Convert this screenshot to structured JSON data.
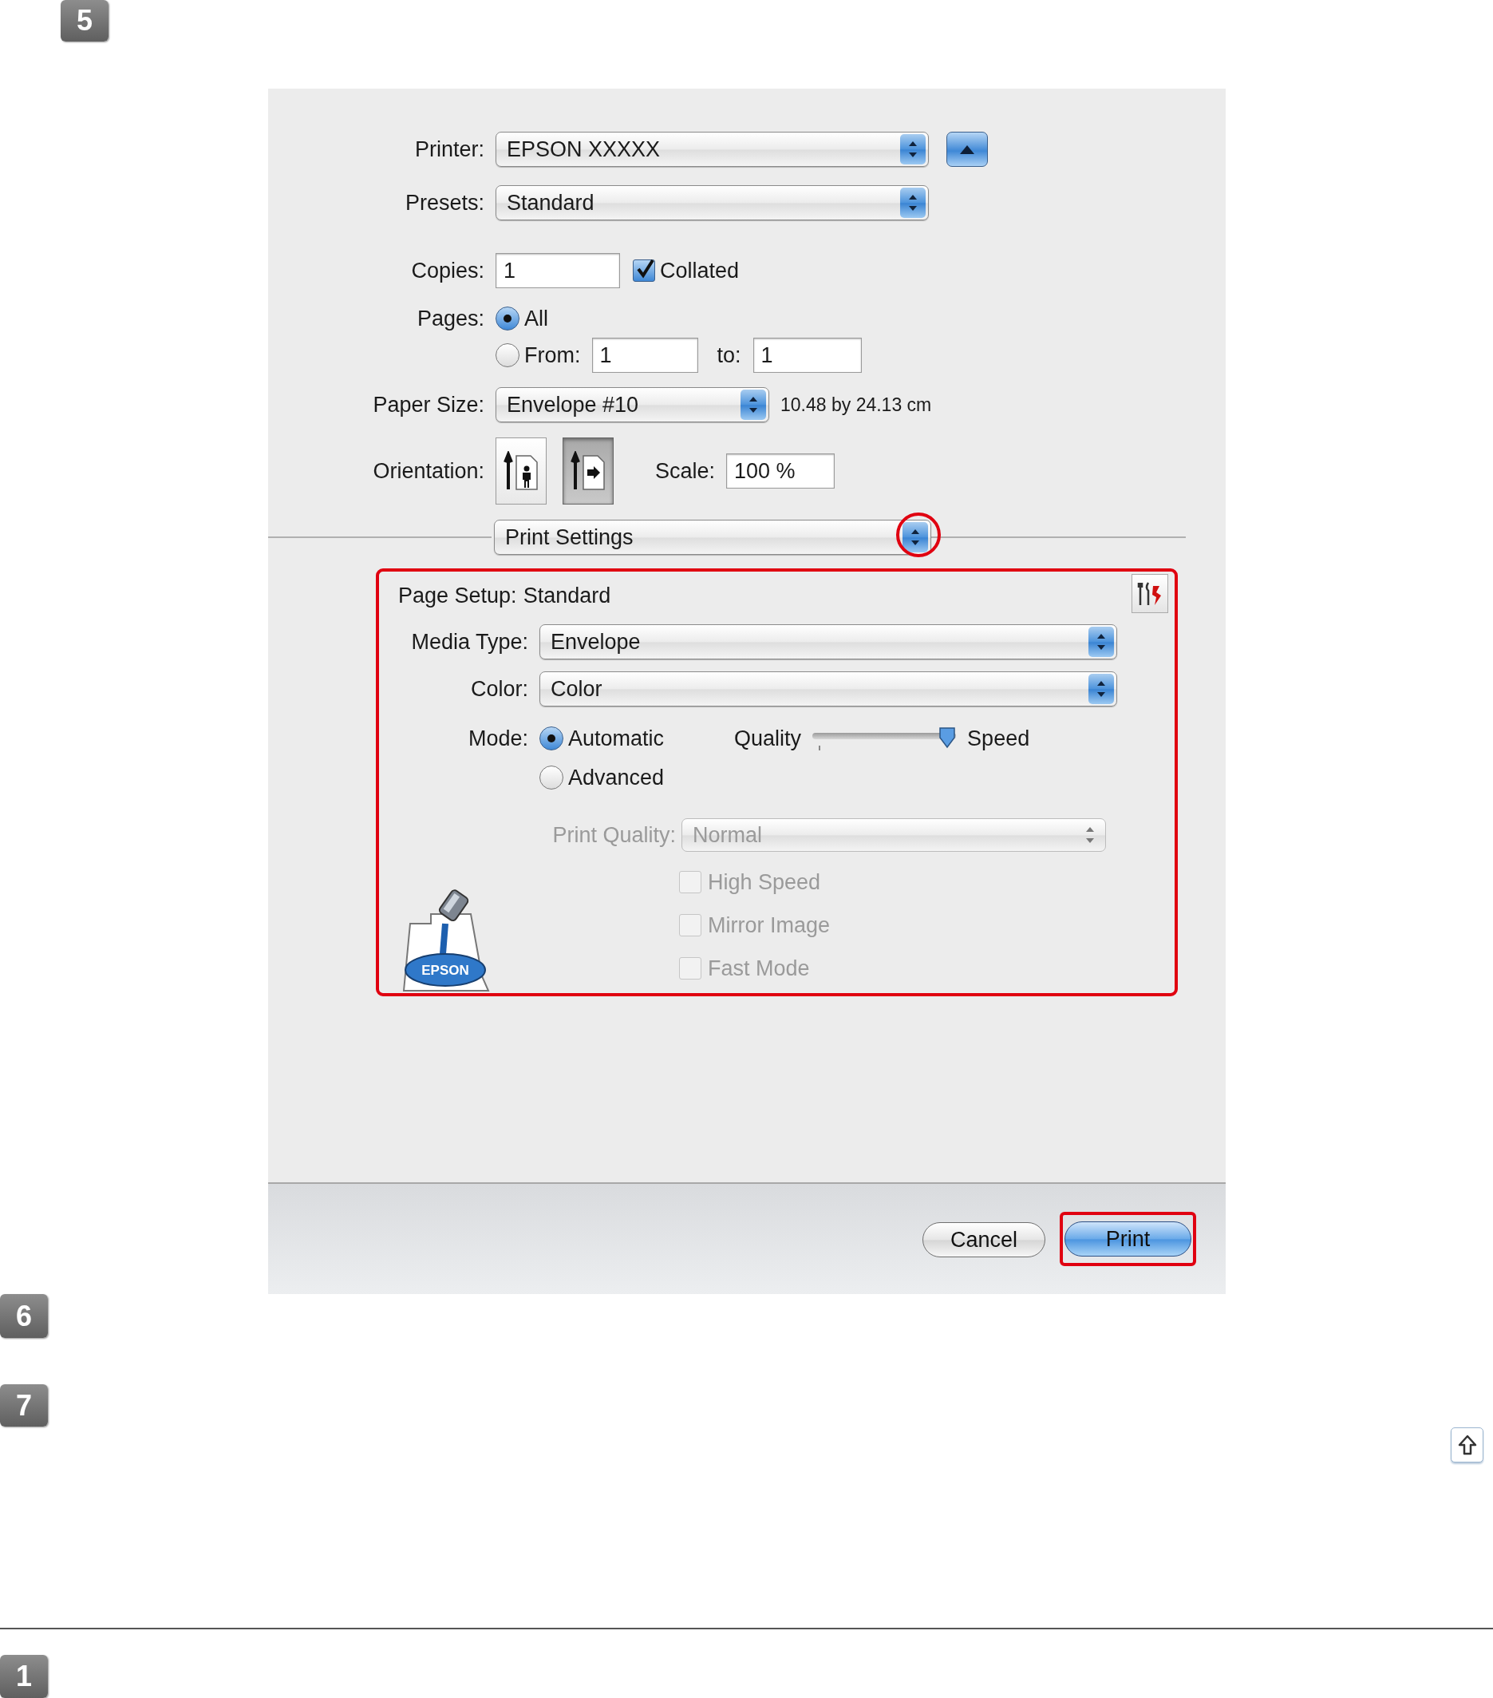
{
  "steps": [
    {
      "number": "5"
    },
    {
      "number": "6"
    },
    {
      "number": "7"
    },
    {
      "number": "1"
    }
  ],
  "dialog": {
    "printer": {
      "label": "Printer:",
      "value": "EPSON XXXXX"
    },
    "presets": {
      "label": "Presets:",
      "value": "Standard"
    },
    "copies": {
      "label": "Copies:",
      "value": "1",
      "collated": {
        "label": "Collated",
        "checked": true
      }
    },
    "pages": {
      "label": "Pages:",
      "options": [
        {
          "label": "All",
          "selected": true
        },
        {
          "label": "From:",
          "selected": false
        }
      ],
      "from": "1",
      "to_label": "to:",
      "to": "1"
    },
    "paper_size": {
      "label": "Paper Size:",
      "value": "Envelope #10",
      "dimensions": "10.48 by 24.13 cm"
    },
    "orientation": {
      "label": "Orientation:",
      "options": [
        {
          "kind": "portrait",
          "selected": false
        },
        {
          "kind": "landscape",
          "selected": true
        }
      ]
    },
    "scale": {
      "label": "Scale:",
      "value": "100 %"
    },
    "panel_menu": {
      "value": "Print Settings"
    },
    "print_settings": {
      "page_setup": {
        "label": "Page Setup:",
        "value": "Standard"
      },
      "media_type": {
        "label": "Media Type:",
        "value": "Envelope"
      },
      "color": {
        "label": "Color:",
        "value": "Color"
      },
      "mode": {
        "label": "Mode:",
        "options": [
          {
            "label": "Automatic",
            "selected": true
          },
          {
            "label": "Advanced",
            "selected": false
          }
        ]
      },
      "slider": {
        "min_label": "Quality",
        "max_label": "Speed",
        "level": 1
      },
      "print_quality": {
        "label": "Print Quality:",
        "value": "Normal",
        "disabled": true
      },
      "logo_text": "EPSON",
      "options": [
        {
          "label": "High Speed",
          "checked": false,
          "disabled": true
        },
        {
          "label": "Mirror Image",
          "checked": false,
          "disabled": true
        },
        {
          "label": "Fast Mode",
          "checked": false,
          "disabled": true
        }
      ]
    },
    "buttons": [
      {
        "label": "Cancel",
        "kind": "secondary"
      },
      {
        "label": "Print",
        "kind": "default"
      }
    ]
  }
}
